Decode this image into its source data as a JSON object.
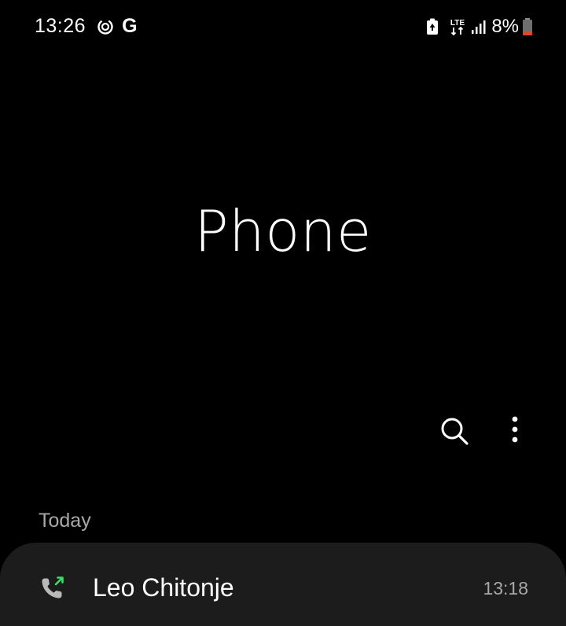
{
  "status_bar": {
    "time": "13:26",
    "google_glyph": "G",
    "battery_percent": "8%",
    "network_type": "LTE",
    "icons": [
      "data-saver-icon",
      "google-icon",
      "battery-saver-icon",
      "lte-icon",
      "signal-icon",
      "battery-icon"
    ]
  },
  "app": {
    "title": "Phone"
  },
  "toolbar": {
    "icons": [
      "search-icon",
      "more-options-icon"
    ]
  },
  "call_log": {
    "section_label": "Today",
    "entries": [
      {
        "name": "Leo Chitonje",
        "time": "13:18",
        "call_type": "outgoing",
        "icon": "outgoing-call-icon"
      }
    ]
  },
  "colors": {
    "background": "#000000",
    "card": "#1c1c1c",
    "secondary_text": "#a8a8a8",
    "outgoing_arrow": "#3ddc6a",
    "battery_low": "#e0452f"
  }
}
